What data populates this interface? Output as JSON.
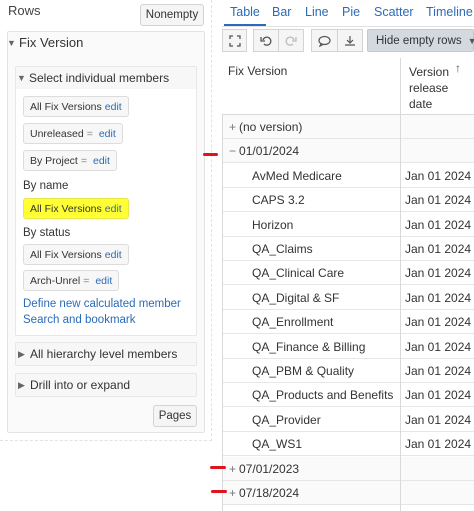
{
  "left": {
    "title": "Rows",
    "nonempty_label": "Nonempty",
    "fix_version": {
      "label": "Fix Version",
      "select_label": "Select individual members",
      "chips_top": [
        {
          "text": "All Fix Versions",
          "eq": "",
          "edit": "edit"
        },
        {
          "text": "Unreleased",
          "eq": "=",
          "edit": "edit"
        },
        {
          "text": "By Project",
          "eq": "=",
          "edit": "edit"
        }
      ],
      "by_name_label": "By name",
      "by_name_chip": {
        "text": "All Fix Versions",
        "edit": "edit"
      },
      "by_status_label": "By status",
      "chips_status": [
        {
          "text": "All Fix Versions",
          "eq": "",
          "edit": "edit"
        },
        {
          "text": "Arch-Unrel",
          "eq": "=",
          "edit": "edit"
        }
      ],
      "define_link": "Define new calculated member",
      "search_link": "Search and bookmark",
      "all_levels_label": "All hierarchy level members",
      "drill_label": "Drill into or expand"
    },
    "pages_label": "Pages"
  },
  "tabs": [
    "Table",
    "Bar",
    "Line",
    "Pie",
    "Scatter",
    "Timeline"
  ],
  "active_tab": "Table",
  "toolbar": {
    "hide_empty_label": "Hide empty rows",
    "icons": [
      "fullscreen-icon",
      "undo-icon",
      "redo-icon",
      "comment-icon",
      "export-icon"
    ]
  },
  "table": {
    "col_fix": "Fix Version",
    "col_date_lines": [
      "Version",
      "release",
      "date"
    ],
    "sort_arrow": "↑",
    "rows": [
      {
        "type": "group",
        "sign": "+",
        "name": "(no version)",
        "date": ""
      },
      {
        "type": "group",
        "sign": "−",
        "name": "01/01/2024",
        "date": ""
      },
      {
        "type": "item",
        "name": "AvMed Medicare",
        "date": "Jan 01 2024"
      },
      {
        "type": "item",
        "name": "CAPS 3.2",
        "date": "Jan 01 2024"
      },
      {
        "type": "item",
        "name": "Horizon",
        "date": "Jan 01 2024"
      },
      {
        "type": "item",
        "name": "QA_Claims",
        "date": "Jan 01 2024"
      },
      {
        "type": "item",
        "name": "QA_Clinical Care",
        "date": "Jan 01 2024"
      },
      {
        "type": "item",
        "name": "QA_Digital & SF",
        "date": "Jan 01 2024"
      },
      {
        "type": "item",
        "name": "QA_Enrollment",
        "date": "Jan 01 2024"
      },
      {
        "type": "item",
        "name": "QA_Finance & Billing",
        "date": "Jan 01 2024"
      },
      {
        "type": "item",
        "name": "QA_PBM & Quality",
        "date": "Jan 01 2024"
      },
      {
        "type": "item",
        "name": "QA_Products and Benefits",
        "date": "Jan 01 2024"
      },
      {
        "type": "item",
        "name": "QA_Provider",
        "date": "Jan 01 2024"
      },
      {
        "type": "item",
        "name": "QA_WS1",
        "date": "Jan 01 2024"
      },
      {
        "type": "group",
        "sign": "+",
        "name": "07/01/2023",
        "date": ""
      },
      {
        "type": "group",
        "sign": "+",
        "name": "07/18/2024",
        "date": ""
      }
    ]
  },
  "colors": {
    "accent": "#2c6bb7",
    "highlight": "#ffff33",
    "annotation": "#e0141c"
  }
}
